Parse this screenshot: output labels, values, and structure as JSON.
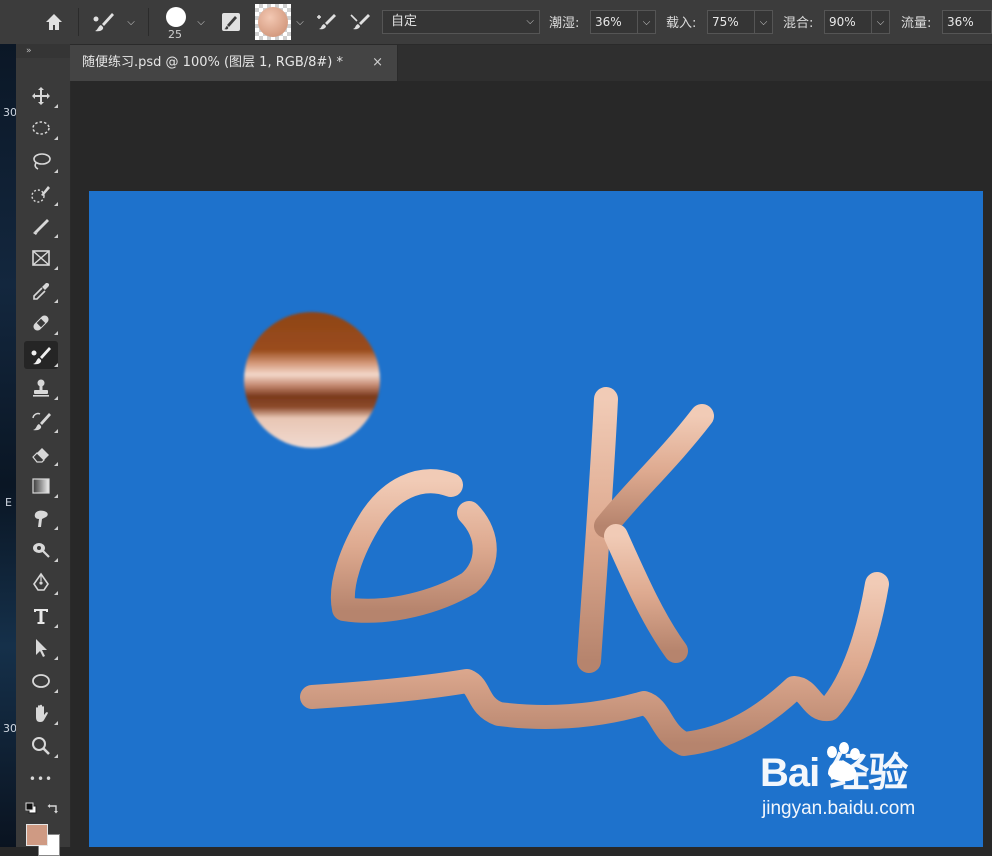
{
  "options_bar": {
    "brush_size": "25",
    "preset": "自定",
    "wet_label": "潮湿:",
    "wet_value": "36%",
    "load_label": "载入:",
    "load_value": "75%",
    "mix_label": "混合:",
    "mix_value": "90%",
    "flow_label": "流量:",
    "flow_value": "36%"
  },
  "document_tab": {
    "title": "随便练习.psd @ 100% (图层 1, RGB/8#) *",
    "close": "×"
  },
  "toolbar": {
    "collapse": "»",
    "more": "•••",
    "tools": [
      "move",
      "marquee",
      "lasso",
      "quick-selection",
      "slice",
      "frame",
      "eyedropper",
      "healing",
      "mixer-brush",
      "stamp",
      "history-brush",
      "eraser",
      "gradient",
      "smudge",
      "dodge",
      "pen",
      "type",
      "path-selection",
      "ellipse",
      "hand",
      "zoom"
    ],
    "active_tool": "mixer-brush",
    "foreground_color": "#cf9a83",
    "background_color": "#ffffff"
  },
  "desktop_edge": [
    "30",
    "E",
    "30"
  ],
  "canvas": {
    "background": "#1e72cc",
    "stroke_color": "#e9b9a0"
  },
  "watermark": {
    "brand": "Bai 经验",
    "url": "jingyan.baidu.com"
  }
}
